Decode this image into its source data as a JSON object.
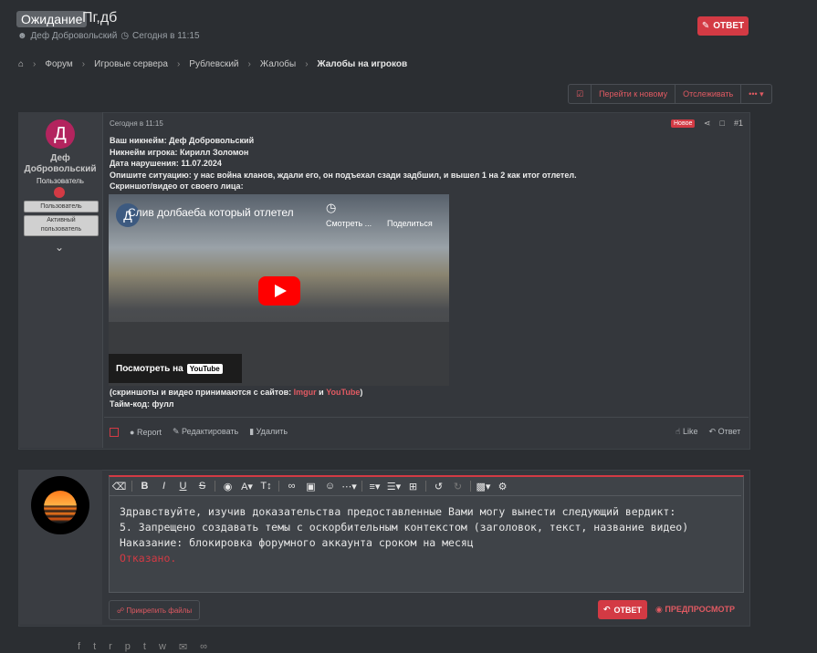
{
  "thread": {
    "prefix": "Ожидание",
    "title": "Пг,дб",
    "author": "Деф Добровольский",
    "date": "Сегодня в 11:15",
    "reply_label": "ОТВЕТ"
  },
  "breadcrumbs": [
    "Форум",
    "Игровые сервера",
    "Рублевский",
    "Жалобы",
    "Жалобы на игроков"
  ],
  "tools": {
    "goto_new": "Перейти к новому",
    "watch": "Отслеживать",
    "more": "•••"
  },
  "post": {
    "user": {
      "avatar_letter": "Д",
      "name_line1": "Деф",
      "name_line2": "Добровольский",
      "title": "Пользователь",
      "banner1": "Пользователь",
      "banner2_line1": "Активный",
      "banner2_line2": "пользователь"
    },
    "date": "Сегодня в 11:15",
    "new_badge": "Новое",
    "number": "#1",
    "lines": [
      "Ваш никнейм: Деф Добровольский",
      "Никнейм игрока: Кирилл Золомон",
      "Дата нарушения: 11.07.2024",
      "Опишите ситуацию: у нас война кланов, ждали его, он подъехал сзади задбшил, и вышел 1 на 2 как итог отлетел.",
      "Скриншот/видео от своего лица:"
    ],
    "video": {
      "channel_letter": "Д",
      "title": "Слив долбаеба который отлетел",
      "watch_later": "Смотреть ...",
      "share": "Поделиться",
      "watch_on": "Посмотреть на",
      "yt": "YouTube"
    },
    "after_prefix": "(скриншоты и видео принимаются с сайтов: ",
    "link_imgur": "Imgur",
    "and_word": " и ",
    "link_youtube": "YouTube",
    "after_suffix": ")",
    "timecode": "Тайм-код: фулл",
    "actions": {
      "report": "Report",
      "edit": "Редактировать",
      "delete": "Удалить",
      "like": "Like",
      "reply": "Ответ"
    }
  },
  "reply_box": {
    "text_lines": [
      "Здравствуйте, изучив доказательства предоставленные Вами могу вынести следующий вердикт:",
      "5. Запрещено создавать темы с оскорбительным контекстом (заголовок, текст, название видео)",
      "Наказание: блокировка форумного аккаунта сроком на месяц"
    ],
    "verdict": "Отказано.",
    "attach": "Прикрепить файлы",
    "send": "ОТВЕТ",
    "preview": "ПРЕДПРОСМОТР"
  },
  "colors": {
    "accent": "#d33a44",
    "background": "#2b2e32",
    "panel": "#34373c"
  }
}
